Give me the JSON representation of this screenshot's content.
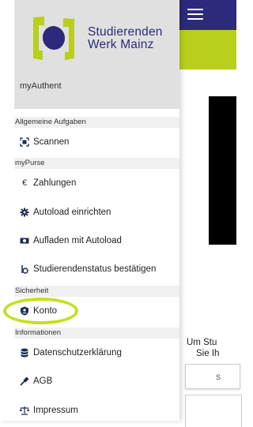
{
  "brand": {
    "line1": "Studierenden",
    "line2": "Werk Mainz"
  },
  "account": {
    "name": "myAuthent"
  },
  "menu": {
    "general": {
      "title": "Allgemeine Aufgaben",
      "items": [
        {
          "label": "Scannen",
          "icon": "qr-scan-icon"
        }
      ]
    },
    "purse": {
      "title": "myPurse",
      "items": [
        {
          "label": "Zahlungen",
          "icon": "euro-icon"
        },
        {
          "label": "Autoload einrichten",
          "icon": "gear-icon"
        },
        {
          "label": "Aufladen mit Autoload",
          "icon": "cash-icon"
        },
        {
          "label": "Studierendenstatus bestätigen",
          "icon": "student-icon"
        }
      ]
    },
    "security": {
      "title": "Sicherheit",
      "items": [
        {
          "label": "Konto",
          "icon": "shield-user-icon"
        }
      ]
    },
    "info": {
      "title": "Informationen",
      "items": [
        {
          "label": "Datenschutzerklärung",
          "icon": "database-icon"
        },
        {
          "label": "AGB",
          "icon": "gavel-icon"
        },
        {
          "label": "Impressum",
          "icon": "scale-icon"
        }
      ]
    }
  },
  "background": {
    "text_line1": "Um Stu",
    "text_line2": "Sie Ih",
    "button_text": "S"
  },
  "colors": {
    "brand_blue": "#2c2a7a",
    "brand_green": "#b8cf1b",
    "highlight": "#c6df1f"
  }
}
